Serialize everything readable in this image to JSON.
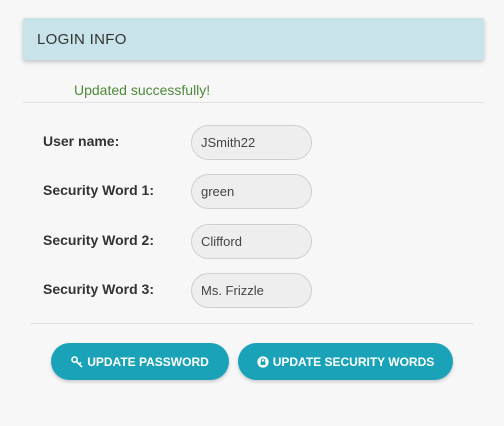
{
  "panel": {
    "title": "LOGIN INFO",
    "header_color": "#c8e3ea"
  },
  "status": {
    "message": "Updated successfully!",
    "color": "#4c8a3a"
  },
  "form": {
    "fields": [
      {
        "label": "User name:",
        "value": "JSmith22"
      },
      {
        "label": "Security Word 1:",
        "value": "green"
      },
      {
        "label": "Security Word 2:",
        "value": "Clifford"
      },
      {
        "label": "Security Word 3:",
        "value": "Ms. Frizzle"
      }
    ]
  },
  "actions": {
    "update_password_label": "UPDATE PASSWORD",
    "update_password_icon": "key-icon",
    "update_security_label": "UPDATE SECURITY WORDS",
    "update_security_icon": "lock-icon",
    "button_color": "#1aa3b8"
  }
}
